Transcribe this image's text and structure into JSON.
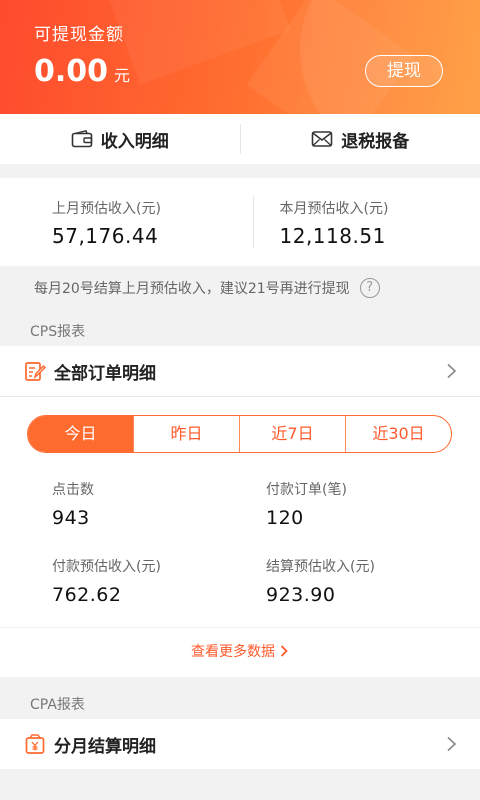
{
  "header": {
    "label": "可提现金额",
    "amount": "0.00",
    "unit": "元",
    "withdraw_label": "提现"
  },
  "actions": [
    {
      "label": "收入明细",
      "icon": "wallet-icon"
    },
    {
      "label": "退税报备",
      "icon": "envelope-icon"
    }
  ],
  "estimates": [
    {
      "label": "上月预估收入(元)",
      "value": "57,176.44"
    },
    {
      "label": "本月预估收入(元)",
      "value": "12,118.51"
    }
  ],
  "notice": {
    "text": "每月20号结算上月预估收入，建议21号再进行提现",
    "help": "?"
  },
  "cps": {
    "section_label": "CPS报表",
    "detail_label": "全部订单明细",
    "tabs": [
      "今日",
      "昨日",
      "近7日",
      "近30日"
    ],
    "active_tab": 0,
    "stats": [
      {
        "label": "点击数",
        "value": "943"
      },
      {
        "label": "付款订单(笔)",
        "value": "120"
      },
      {
        "label": "付款预估收入(元)",
        "value": "762.62"
      },
      {
        "label": "结算预估收入(元)",
        "value": "923.90"
      }
    ],
    "more_label": "查看更多数据"
  },
  "cpa": {
    "section_label": "CPA报表",
    "detail_label": "分月结算明细"
  },
  "colors": {
    "accent": "#ff5a2c",
    "header_start": "#ff4a2e",
    "header_end": "#ff9a3a"
  }
}
